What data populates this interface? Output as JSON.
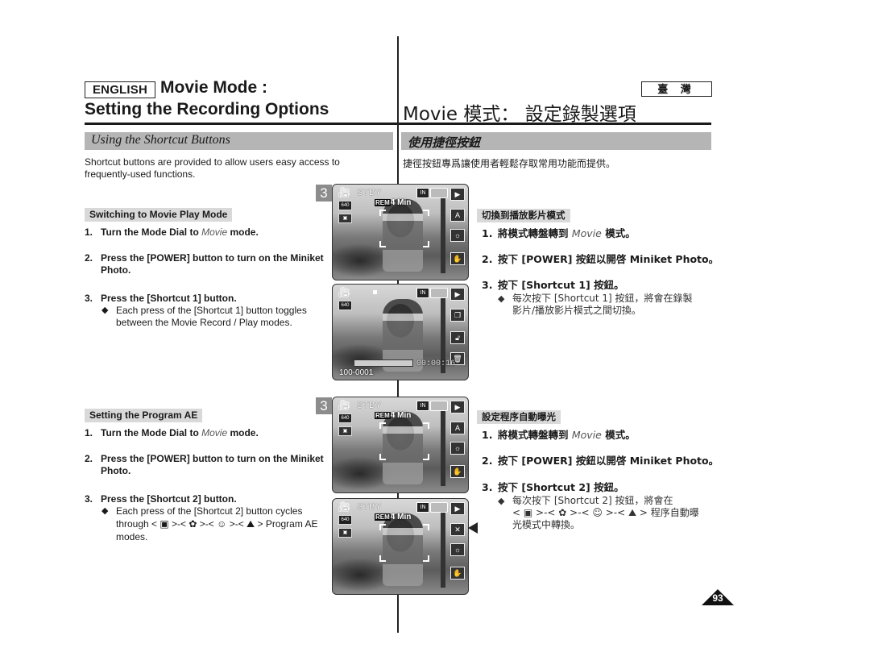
{
  "header": {
    "language_badge_en": "ENGLISH",
    "title_en_line1": "Movie Mode :",
    "title_en_line2": "Setting the Recording Options",
    "language_badge_tw": "臺 灣",
    "title_tw": "Movie  模式：  設定錄製選項"
  },
  "section": {
    "title_en": "Using the Shortcut Buttons",
    "title_tw": "使用捷徑按鈕",
    "intro_en": "Shortcut buttons are provided to allow users easy access to frequently-used functions.",
    "intro_tw": "捷徑按鈕專爲讓使用者輕鬆存取常用功能而提供。"
  },
  "play_mode": {
    "subhead_en": "Switching to Movie Play Mode",
    "subhead_tw": "切換到播放影片模式",
    "steps_en": [
      {
        "num": "1.",
        "pre": "Turn the Mode Dial to ",
        "em": "Movie",
        "post": " mode."
      },
      {
        "num": "2.",
        "text": "Press the [POWER] button to turn on the Miniket Photo."
      },
      {
        "num": "3.",
        "text": "Press the [Shortcut 1] button."
      }
    ],
    "bullet_en": "Each press of the [Shortcut 1] button toggles between the Movie Record / Play modes.",
    "steps_tw": [
      {
        "num": "1.",
        "pre": "將模式轉盤轉到 ",
        "em": "Movie",
        "post": "  模式。"
      },
      {
        "num": "2.",
        "text": "按下 [POWER]  按鈕以開啓 Miniket Photo。"
      },
      {
        "num": "3.",
        "text": "按下 [Shortcut 1]  按鈕。"
      }
    ],
    "bullet_tw_line1": "每次按下 [Shortcut 1] 按鈕，將會在錄製",
    "bullet_tw_line2": "影片/播放影片模式之間切換。"
  },
  "program_ae": {
    "subhead_en": "Setting the Program AE",
    "subhead_tw": "設定程序自動曝光",
    "steps_en": [
      {
        "num": "1.",
        "pre": "Turn the Mode Dial to ",
        "em": "Movie",
        "post": " mode."
      },
      {
        "num": "2.",
        "text": "Press the [POWER] button to turn on the Miniket Photo."
      },
      {
        "num": "3.",
        "text": "Press the [Shortcut 2] button."
      }
    ],
    "bullet_en_line1": "Each press of the [Shortcut 2] button cycles",
    "bullet_en_line2": "through < ▣ >-< ✿ >-< ☺ >-< ⛰ > Program AE",
    "bullet_en_line3": "modes.",
    "steps_tw": [
      {
        "num": "1.",
        "pre": "將模式轉盤轉到 ",
        "em": "Movie",
        "post": "  模式。"
      },
      {
        "num": "2.",
        "text": "按下 [POWER]  按鈕以開啓 Miniket Photo。"
      },
      {
        "num": "3.",
        "text": "按下 [Shortcut 2]  按鈕。"
      }
    ],
    "bullet_tw_line1": "每次按下 [Shortcut 2] 按鈕，將會在",
    "bullet_tw_line2": "< ▣ >-< ✿ >-< ☺ >-< ⛰ > 程序自動曝",
    "bullet_tw_line3": "光模式中轉換。"
  },
  "screens": {
    "step_badge": "3",
    "stby": "STBY",
    "rem_label": "REM",
    "rem_value": "4 Min",
    "resolution": "640",
    "in_label": "IN",
    "file_number": "100-0001",
    "timer": "00:00:16",
    "mode_icon": "movie-camera-icon",
    "side_icons_record": [
      "play-mode-icon",
      "program-ae-icon",
      "white-balance-icon",
      "shortcut-icon"
    ],
    "side_icons_play": [
      "play-mode-icon",
      "slideshow-icon",
      "protect-icon",
      "delete-icon"
    ]
  },
  "footer": {
    "page_number": "93"
  }
}
